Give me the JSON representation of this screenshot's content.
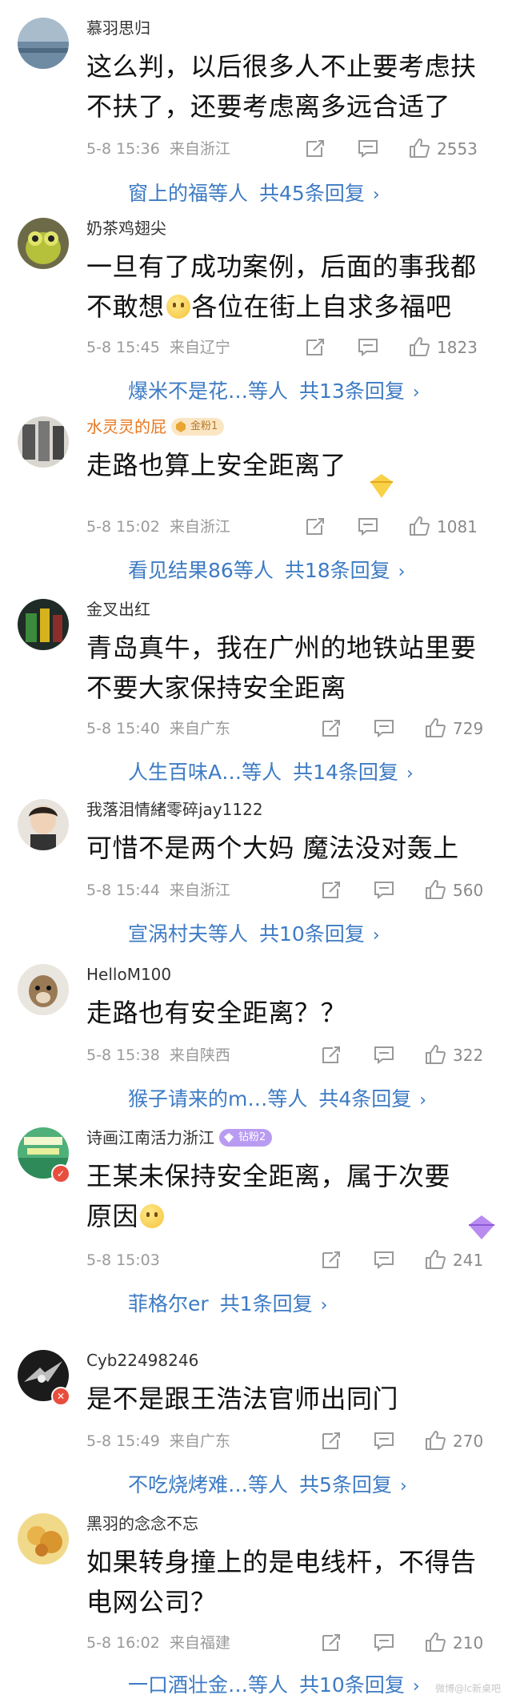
{
  "comments": [
    {
      "username": "慕羽思归",
      "lines": [
        "这么判，以后很多人不止要考虑扶",
        "不扶了，还要考虑离多远合适了"
      ],
      "time": "5-8 15:36",
      "location": "来自浙江",
      "likes": "2553",
      "reply_from": "窗上的福",
      "reply_etc": "等人",
      "reply_count": "共45条回复",
      "chevron": "›"
    },
    {
      "username": "奶茶鸡翅尖",
      "lines": [
        "一旦有了成功案例，后面的事我都",
        "不敢想",
        "各位在街上自求多福吧"
      ],
      "time": "5-8 15:45",
      "location": "来自辽宁",
      "likes": "1823",
      "reply_from": "爆米不是花…",
      "reply_etc": "等人",
      "reply_count": "共13条回复",
      "chevron": "›"
    },
    {
      "username": "水灵灵的屁",
      "badge": "金粉1",
      "lines": [
        "走路也算上安全距离了"
      ],
      "time": "5-8 15:02",
      "location": "来自浙江",
      "likes": "1081",
      "reply_from": "看见结果86",
      "reply_etc": "等人",
      "reply_count": "共18条回复",
      "chevron": "›"
    },
    {
      "username": "金叉出红",
      "lines": [
        "青岛真牛，我在广州的地铁站里要",
        "不要大家保持安全距离"
      ],
      "time": "5-8 15:40",
      "location": "来自广东",
      "likes": "729",
      "reply_from": "人生百味A…",
      "reply_etc": "等人",
      "reply_count": "共14条回复",
      "chevron": "›"
    },
    {
      "username": "我落泪情緒零碎jay1122",
      "lines": [
        "可惜不是两个大妈 魔法没对轰上"
      ],
      "time": "5-8 15:44",
      "location": "来自浙江",
      "likes": "560",
      "reply_from": "宣涡村夫",
      "reply_etc": "等人",
      "reply_count": "共10条回复",
      "chevron": "›"
    },
    {
      "username": "HelloM100",
      "lines": [
        "走路也有安全距离？？"
      ],
      "time": "5-8 15:38",
      "location": "来自陕西",
      "likes": "322",
      "reply_from": "猴子请来的m…",
      "reply_etc": "等人",
      "reply_count": "共4条回复",
      "chevron": "›"
    },
    {
      "username": "诗画江南活力浙江",
      "badge": "钻粉2",
      "lines": [
        "王某未保持安全距离，属于次要",
        "原因"
      ],
      "time": "5-8 15:03",
      "location": "",
      "likes": "241",
      "reply_from": "菲格尔er",
      "reply_etc": "",
      "reply_count": "共1条回复",
      "chevron": "›"
    },
    {
      "username": "Cyb22498246",
      "lines": [
        "是不是跟王浩法官师出同门"
      ],
      "time": "5-8 15:49",
      "location": "来自广东",
      "likes": "270",
      "reply_from": "不吃烧烤难…",
      "reply_etc": "等人",
      "reply_count": "共5条回复",
      "chevron": "›"
    },
    {
      "username": "黑羽的念念不忘",
      "lines": [
        "如果转身撞上的是电线杆，不得告",
        "电网公司？"
      ],
      "time": "5-8 16:02",
      "location": "来自福建",
      "likes": "210",
      "reply_from": "一口酒壮金…",
      "reply_etc": "等人",
      "reply_count": "共10条回复",
      "chevron": "›"
    }
  ],
  "watermark": "微博@lc新桌吧",
  "colors": {
    "link": "#3d7bc4",
    "meta": "#9a9a9a",
    "username_orange": "#e8771e"
  },
  "icons": [
    "share-icon",
    "comment-icon",
    "thumbs-up-icon",
    "chevron-right-icon",
    "verified-badge-icon"
  ]
}
